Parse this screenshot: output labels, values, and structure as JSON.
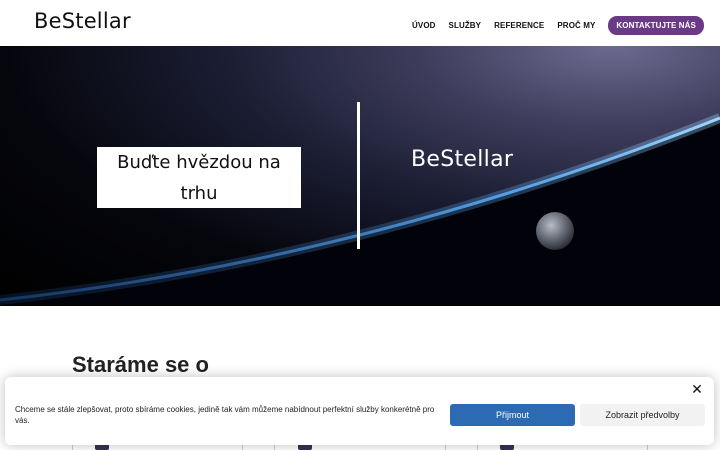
{
  "header": {
    "logo": "BeStellar",
    "nav": [
      "ÚVOD",
      "SLUŽBY",
      "REFERENCE",
      "PROČ MY"
    ],
    "cta": "KONTAKTUJTE NÁS"
  },
  "hero": {
    "headline": "Buďte hvězdou na trhu",
    "logo": "BeStellar"
  },
  "section": {
    "title": "Staráme se o"
  },
  "cookie": {
    "text": "Chceme se stále zlepšovat, proto sbíráme cookies, jedině tak vám můžeme nabídnout perfektní služby konkerétně pro vás.",
    "accept": "Přijmout",
    "preferences": "Zobrazit předvolby",
    "close": "✕"
  },
  "colors": {
    "accent": "#6a3a86",
    "primary_button": "#2c6bb3"
  }
}
